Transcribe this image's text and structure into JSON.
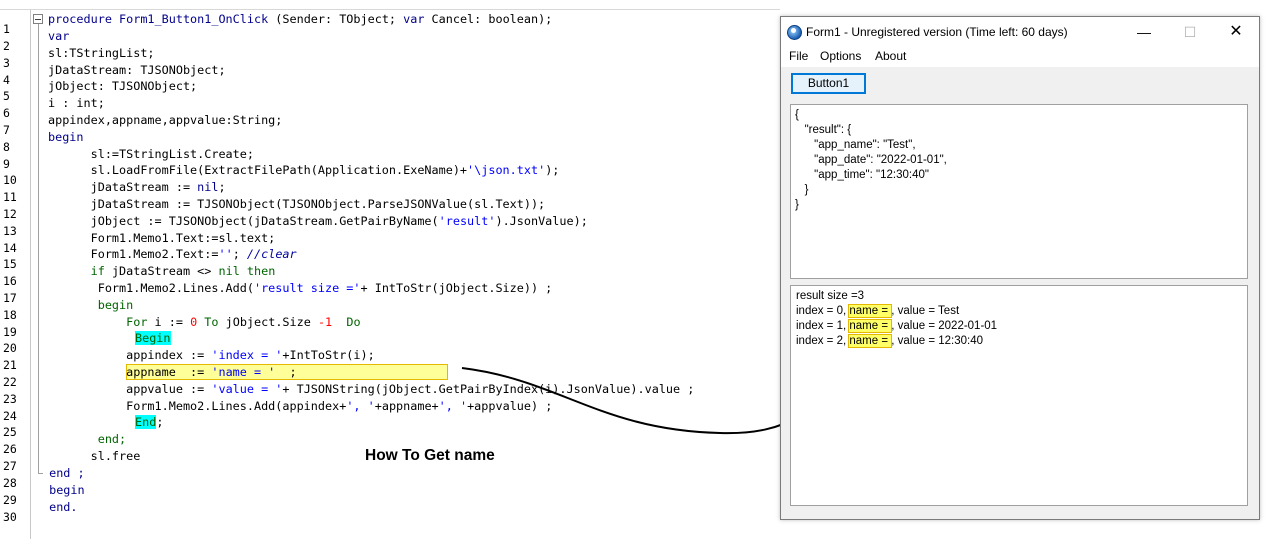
{
  "editor": {
    "line_numbers": [
      "1",
      "2",
      "3",
      "4",
      "5",
      "6",
      "7",
      "8",
      "9",
      "10",
      "11",
      "12",
      "13",
      "14",
      "15",
      "16",
      "17",
      "18",
      "19",
      "20",
      "21",
      "22",
      "23",
      "24",
      "25",
      "26",
      "27",
      "28",
      "29",
      "30"
    ],
    "code": {
      "l1_a": "procedure",
      "l1_b": " Form1_Button1_OnClick ",
      "l1_c": "(Sender: TObject; ",
      "l1_d": "var",
      "l1_e": " Cancel: boolean);",
      "l2": "var",
      "l3": "sl:TStringList;",
      "l4": "jDataStream: TJSONObject;",
      "l5": "jObject: TJSONObject;",
      "l6": "i : int;",
      "l7": "appindex,appname,appvalue:String;",
      "l8": "begin",
      "l9": "      sl:=TStringList.Create;",
      "l10_a": "      sl.LoadFromFile(ExtractFilePath(Application.ExeName)+",
      "l10_b": "'\\json.txt'",
      "l10_c": ");",
      "l11_a": "      jDataStream := ",
      "l11_b": "nil",
      "l11_c": ";",
      "l12": "      jDataStream := TJSONObject(TJSONObject.ParseJSONValue(sl.Text));",
      "l13_a": "      jObject := TJSONObject(jDataStream.GetPairByName(",
      "l13_b": "'result'",
      "l13_c": ").JsonValue);",
      "l14": "      Form1.Memo1.Text:=sl.text;",
      "l15_a": "      Form1.Memo2.Text:=",
      "l15_b": "''",
      "l15_c": "; ",
      "l15_d": "//clear",
      "l16_a": "      ",
      "l16_b": "if",
      "l16_c": " jDataStream <> ",
      "l16_d": "nil",
      "l16_e": " ",
      "l16_f": "then",
      "l17_a": "       Form1.Memo2.Lines.Add(",
      "l17_b": "'result size ='",
      "l17_c": "+ IntToStr(jObject.Size)) ;",
      "l18": "       begin",
      "l19_a": "           ",
      "l19_b": "For",
      "l19_c": " i := ",
      "l19_d": "0",
      "l19_e": " ",
      "l19_f": "To",
      "l19_g": " jObject.Size ",
      "l19_h": "-1",
      "l19_i": "  ",
      "l19_j": "Do",
      "l20": "Begin",
      "l21_a": "           appindex := ",
      "l21_b": "'index = '",
      "l21_c": "+IntToStr(i);",
      "l22_a": "           appname  := ",
      "l22_b": "'name = '",
      "l22_c": "  ;",
      "l23_a": "           appvalue := ",
      "l23_b": "'value = '",
      "l23_c": "+ TJSONString(jObject.GetPairByIndex(i).JsonValue).value ;",
      "l24_a": "           Form1.Memo2.Lines.Add(appindex+",
      "l24_b": "', '",
      "l24_c": "+appname+",
      "l24_d": "', '",
      "l24_e": "+appvalue) ;",
      "l25": "End",
      "l25_b": ";",
      "l26": "       end;",
      "l27": "      sl.free",
      "l28": " end ;",
      "l29": " begin",
      "l30": " end."
    },
    "annotation": "How To Get name"
  },
  "form": {
    "title": "Form1 -  Unregistered version (Time left: 60 days)",
    "min_glyph": "—",
    "max_glyph": "☐",
    "close_glyph": "✕",
    "menu": [
      "File",
      "Options",
      "About"
    ],
    "button1_label": "Button1",
    "memo1_lines": [
      "{",
      "   \"result\": {",
      "      \"app_name\": \"Test\",",
      "      \"app_date\": \"2022-01-01\",",
      "      \"app_time\": \"12:30:40\"",
      "   }",
      "}"
    ],
    "memo2": {
      "line0": "result size =3",
      "rows": [
        {
          "index": "index = 0, ",
          "name": "name = ",
          "value": ", value = Test"
        },
        {
          "index": "index = 1, ",
          "name": "name = ",
          "value": ", value = 2022-01-01"
        },
        {
          "index": "index = 2, ",
          "name": "name = ",
          "value": ", value = 12:30:40"
        }
      ]
    }
  }
}
